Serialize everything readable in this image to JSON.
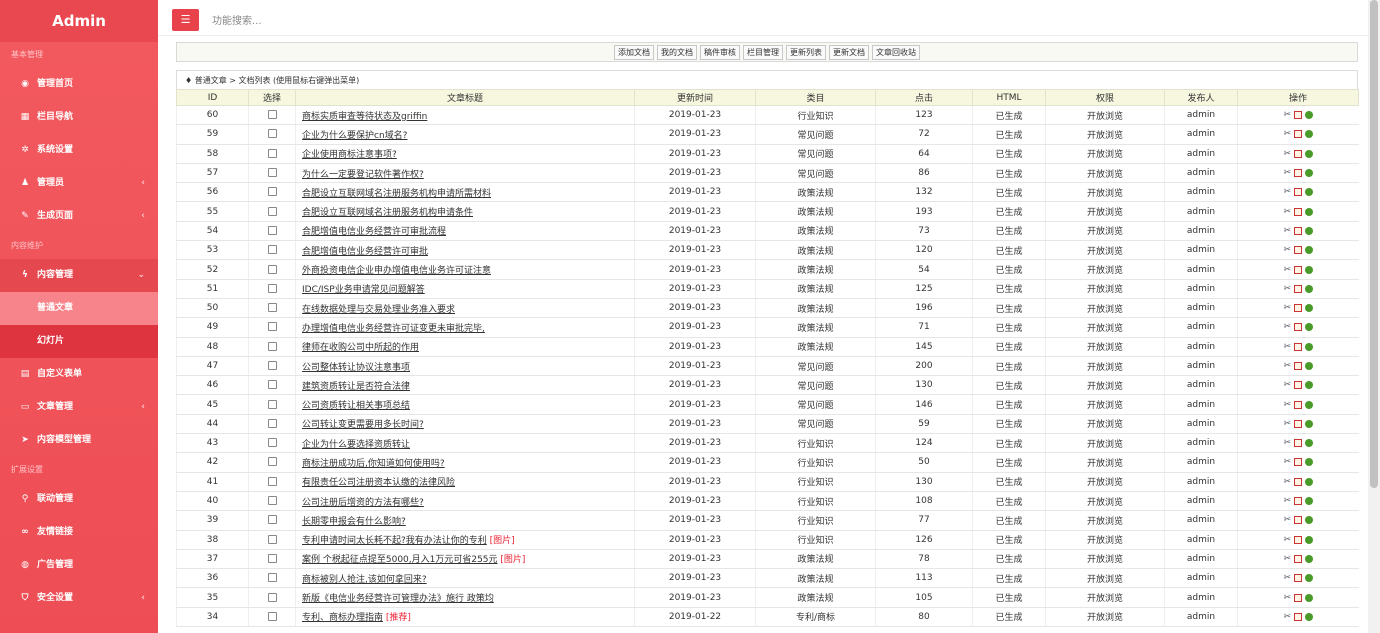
{
  "sidebar": {
    "logo": "Admin",
    "sections": [
      {
        "label": "基本管理"
      },
      {
        "label": "内容维护"
      },
      {
        "label": "扩展设置"
      }
    ],
    "items": [
      {
        "label": "管理首页",
        "icon": "dashboard-icon"
      },
      {
        "label": "栏目导航",
        "icon": "list-icon"
      },
      {
        "label": "系统设置",
        "icon": "gear-icon"
      },
      {
        "label": "管理员",
        "icon": "user-icon"
      },
      {
        "label": "生成页面",
        "icon": "pencil-icon"
      },
      {
        "label": "内容管理",
        "icon": "bolt-icon"
      },
      {
        "label": "普通文章"
      },
      {
        "label": "幻灯片"
      },
      {
        "label": "自定义表单",
        "icon": "form-icon"
      },
      {
        "label": "文章管理",
        "icon": "folder-icon"
      },
      {
        "label": "内容模型管理",
        "icon": "send-icon"
      },
      {
        "label": "联动管理",
        "icon": "pin-icon"
      },
      {
        "label": "友情链接",
        "icon": "link-icon"
      },
      {
        "label": "广告管理",
        "icon": "globe-icon"
      },
      {
        "label": "安全设置",
        "icon": "shield-icon"
      }
    ]
  },
  "topbar": {
    "search_placeholder": "功能搜索..."
  },
  "toolbar": [
    "添加文档",
    "我的文档",
    "稿件审核",
    "栏目管理",
    "更新列表",
    "更新文档",
    "文章回收站"
  ],
  "breadcrumb": "♦ 普通文章 > 文档列表 (使用鼠标右键弹出菜单)",
  "columns": [
    "ID",
    "选择",
    "文章标题",
    "更新时间",
    "类目",
    "点击",
    "HTML",
    "权限",
    "发布人",
    "操作"
  ],
  "rows": [
    {
      "id": "60",
      "title": "商标实质审查等待状态及griffin",
      "tag": "",
      "date": "2019-01-23",
      "cat": "行业知识",
      "clicks": "123",
      "html": "已生成",
      "perm": "开放浏览",
      "author": "admin"
    },
    {
      "id": "59",
      "title": "企业为什么要保护cn域名?",
      "tag": "",
      "date": "2019-01-23",
      "cat": "常见问题",
      "clicks": "72",
      "html": "已生成",
      "perm": "开放浏览",
      "author": "admin"
    },
    {
      "id": "58",
      "title": "企业使用商标注意事项?",
      "tag": "",
      "date": "2019-01-23",
      "cat": "常见问题",
      "clicks": "64",
      "html": "已生成",
      "perm": "开放浏览",
      "author": "admin"
    },
    {
      "id": "57",
      "title": "为什么一定要登记软件著作权?",
      "tag": "",
      "date": "2019-01-23",
      "cat": "常见问题",
      "clicks": "86",
      "html": "已生成",
      "perm": "开放浏览",
      "author": "admin"
    },
    {
      "id": "56",
      "title": "合肥设立互联网域名注册服务机构申请所需材料",
      "tag": "",
      "date": "2019-01-23",
      "cat": "政策法规",
      "clicks": "132",
      "html": "已生成",
      "perm": "开放浏览",
      "author": "admin"
    },
    {
      "id": "55",
      "title": "合肥设立互联网域名注册服务机构申请条件",
      "tag": "",
      "date": "2019-01-23",
      "cat": "政策法规",
      "clicks": "193",
      "html": "已生成",
      "perm": "开放浏览",
      "author": "admin"
    },
    {
      "id": "54",
      "title": "合肥增值电信业务经营许可审批流程",
      "tag": "",
      "date": "2019-01-23",
      "cat": "政策法规",
      "clicks": "73",
      "html": "已生成",
      "perm": "开放浏览",
      "author": "admin"
    },
    {
      "id": "53",
      "title": "合肥增值电信业务经营许可审批",
      "tag": "",
      "date": "2019-01-23",
      "cat": "政策法规",
      "clicks": "120",
      "html": "已生成",
      "perm": "开放浏览",
      "author": "admin"
    },
    {
      "id": "52",
      "title": "外商投资电信企业申办增值电信业务许可证注意",
      "tag": "",
      "date": "2019-01-23",
      "cat": "政策法规",
      "clicks": "54",
      "html": "已生成",
      "perm": "开放浏览",
      "author": "admin"
    },
    {
      "id": "51",
      "title": "IDC/ISP业务申请常见问题解答",
      "tag": "",
      "date": "2019-01-23",
      "cat": "政策法规",
      "clicks": "125",
      "html": "已生成",
      "perm": "开放浏览",
      "author": "admin"
    },
    {
      "id": "50",
      "title": "在线数据处理与交易处理业务准入要求",
      "tag": "",
      "date": "2019-01-23",
      "cat": "政策法规",
      "clicks": "196",
      "html": "已生成",
      "perm": "开放浏览",
      "author": "admin"
    },
    {
      "id": "49",
      "title": "办理增值电信业务经营许可证变更未审批完毕,",
      "tag": "",
      "date": "2019-01-23",
      "cat": "政策法规",
      "clicks": "71",
      "html": "已生成",
      "perm": "开放浏览",
      "author": "admin"
    },
    {
      "id": "48",
      "title": "律师在收购公司中所起的作用",
      "tag": "",
      "date": "2019-01-23",
      "cat": "政策法规",
      "clicks": "145",
      "html": "已生成",
      "perm": "开放浏览",
      "author": "admin"
    },
    {
      "id": "47",
      "title": "公司整体转让协议注意事项",
      "tag": "",
      "date": "2019-01-23",
      "cat": "常见问题",
      "clicks": "200",
      "html": "已生成",
      "perm": "开放浏览",
      "author": "admin"
    },
    {
      "id": "46",
      "title": "建筑资质转让是否符合法律",
      "tag": "",
      "date": "2019-01-23",
      "cat": "常见问题",
      "clicks": "130",
      "html": "已生成",
      "perm": "开放浏览",
      "author": "admin"
    },
    {
      "id": "45",
      "title": "公司资质转让相关事项总结",
      "tag": "",
      "date": "2019-01-23",
      "cat": "常见问题",
      "clicks": "146",
      "html": "已生成",
      "perm": "开放浏览",
      "author": "admin"
    },
    {
      "id": "44",
      "title": "公司转让变更需要用多长时间?",
      "tag": "",
      "date": "2019-01-23",
      "cat": "常见问题",
      "clicks": "59",
      "html": "已生成",
      "perm": "开放浏览",
      "author": "admin"
    },
    {
      "id": "43",
      "title": "企业为什么要选择资质转让",
      "tag": "",
      "date": "2019-01-23",
      "cat": "行业知识",
      "clicks": "124",
      "html": "已生成",
      "perm": "开放浏览",
      "author": "admin"
    },
    {
      "id": "42",
      "title": "商标注册成功后,你知道如何使用吗?",
      "tag": "",
      "date": "2019-01-23",
      "cat": "行业知识",
      "clicks": "50",
      "html": "已生成",
      "perm": "开放浏览",
      "author": "admin"
    },
    {
      "id": "41",
      "title": "有限责任公司注册资本认缴的法律风险",
      "tag": "",
      "date": "2019-01-23",
      "cat": "行业知识",
      "clicks": "130",
      "html": "已生成",
      "perm": "开放浏览",
      "author": "admin"
    },
    {
      "id": "40",
      "title": "公司注册后增资的方法有哪些?",
      "tag": "",
      "date": "2019-01-23",
      "cat": "行业知识",
      "clicks": "108",
      "html": "已生成",
      "perm": "开放浏览",
      "author": "admin"
    },
    {
      "id": "39",
      "title": "长期零申报会有什么影响?",
      "tag": "",
      "date": "2019-01-23",
      "cat": "行业知识",
      "clicks": "77",
      "html": "已生成",
      "perm": "开放浏览",
      "author": "admin"
    },
    {
      "id": "38",
      "title": "专利申请时间太长耗不起?我有办法让你的专利",
      "tag": "[图片]",
      "date": "2019-01-23",
      "cat": "行业知识",
      "clicks": "126",
      "html": "已生成",
      "perm": "开放浏览",
      "author": "admin"
    },
    {
      "id": "37",
      "title": "案例 个税起征点提至5000,月入1万元可省255元",
      "tag": "[图片]",
      "date": "2019-01-23",
      "cat": "政策法规",
      "clicks": "78",
      "html": "已生成",
      "perm": "开放浏览",
      "author": "admin"
    },
    {
      "id": "36",
      "title": "商标被别人抢注,该如何拿回来?",
      "tag": "",
      "date": "2019-01-23",
      "cat": "政策法规",
      "clicks": "113",
      "html": "已生成",
      "perm": "开放浏览",
      "author": "admin"
    },
    {
      "id": "35",
      "title": "新版《电信业务经营许可管理办法》施行 政策均",
      "tag": "",
      "date": "2019-01-23",
      "cat": "政策法规",
      "clicks": "105",
      "html": "已生成",
      "perm": "开放浏览",
      "author": "admin"
    },
    {
      "id": "34",
      "title": "专利、商标办理指南",
      "tag": "[推荐]",
      "date": "2019-01-22",
      "cat": "专利/商标",
      "clicks": "80",
      "html": "已生成",
      "perm": "开放浏览",
      "author": "admin"
    }
  ]
}
